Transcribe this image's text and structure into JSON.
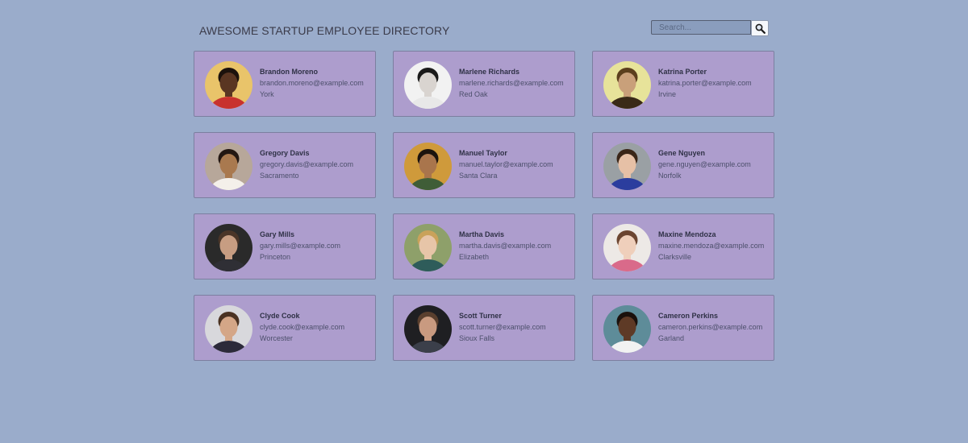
{
  "header": {
    "title": "AWESOME STARTUP EMPLOYEE DIRECTORY",
    "search_placeholder": "Search...",
    "search_icon": "magnifier-icon"
  },
  "colors": {
    "background": "#9aaccb",
    "card": "#ad9dcd",
    "card_border": "#7c7fa0"
  },
  "employees": [
    {
      "name": "Brandon Moreno",
      "email": "brandon.moreno@example.com",
      "city": "York",
      "photo": {
        "bg": "#e9c46a",
        "skin": "#5a3622",
        "hair": "#1c120c",
        "shirt": "#c8322e"
      }
    },
    {
      "name": "Marlene Richards",
      "email": "marlene.richards@example.com",
      "city": "Red Oak",
      "photo": {
        "bg": "#f2f2f2",
        "skin": "#d9d4d0",
        "hair": "#1a1a1a",
        "shirt": "#e8e8e8"
      }
    },
    {
      "name": "Katrina Porter",
      "email": "katrina.porter@example.com",
      "city": "Irvine",
      "photo": {
        "bg": "#e7e39a",
        "skin": "#c9a07a",
        "hair": "#5b3f1d",
        "shirt": "#3a2a18"
      }
    },
    {
      "name": "Gregory Davis",
      "email": "gregory.davis@example.com",
      "city": "Sacramento",
      "photo": {
        "bg": "#b7a79a",
        "skin": "#a9794f",
        "hair": "#231712",
        "shirt": "#f4f0ea"
      }
    },
    {
      "name": "Manuel Taylor",
      "email": "manuel.taylor@example.com",
      "city": "Santa Clara",
      "photo": {
        "bg": "#cf9a3b",
        "skin": "#a9754c",
        "hair": "#1b130e",
        "shirt": "#3f5d37"
      }
    },
    {
      "name": "Gene Nguyen",
      "email": "gene.nguyen@example.com",
      "city": "Norfolk",
      "photo": {
        "bg": "#9aa0a4",
        "skin": "#e6c0a6",
        "hair": "#3a2618",
        "shirt": "#2b3d9e"
      }
    },
    {
      "name": "Gary Mills",
      "email": "gary.mills@example.com",
      "city": "Princeton",
      "photo": {
        "bg": "#2a2a2a",
        "skin": "#c79d82",
        "hair": "#4a3528",
        "shirt": "#2f2f35"
      }
    },
    {
      "name": "Martha Davis",
      "email": "martha.davis@example.com",
      "city": "Elizabeth",
      "photo": {
        "bg": "#8ea06a",
        "skin": "#e7c5a8",
        "hair": "#c9a25a",
        "shirt": "#2e5c5a"
      }
    },
    {
      "name": "Maxine Mendoza",
      "email": "maxine.mendoza@example.com",
      "city": "Clarksville",
      "photo": {
        "bg": "#ede9e6",
        "skin": "#efcfbb",
        "hair": "#6b4531",
        "shirt": "#d96a8a"
      }
    },
    {
      "name": "Clyde Cook",
      "email": "clyde.cook@example.com",
      "city": "Worcester",
      "photo": {
        "bg": "#d8d8dc",
        "skin": "#d4a687",
        "hair": "#4a3222",
        "shirt": "#2c2a3a"
      }
    },
    {
      "name": "Scott Turner",
      "email": "scott.turner@example.com",
      "city": "Sioux Falls",
      "photo": {
        "bg": "#1f1f22",
        "skin": "#c99a80",
        "hair": "#5a3f2e",
        "shirt": "#3b3f4a"
      }
    },
    {
      "name": "Cameron Perkins",
      "email": "cameron.perkins@example.com",
      "city": "Garland",
      "photo": {
        "bg": "#5e8c99",
        "skin": "#5e3a26",
        "hair": "#1a110c",
        "shirt": "#f2f2f2"
      }
    }
  ]
}
